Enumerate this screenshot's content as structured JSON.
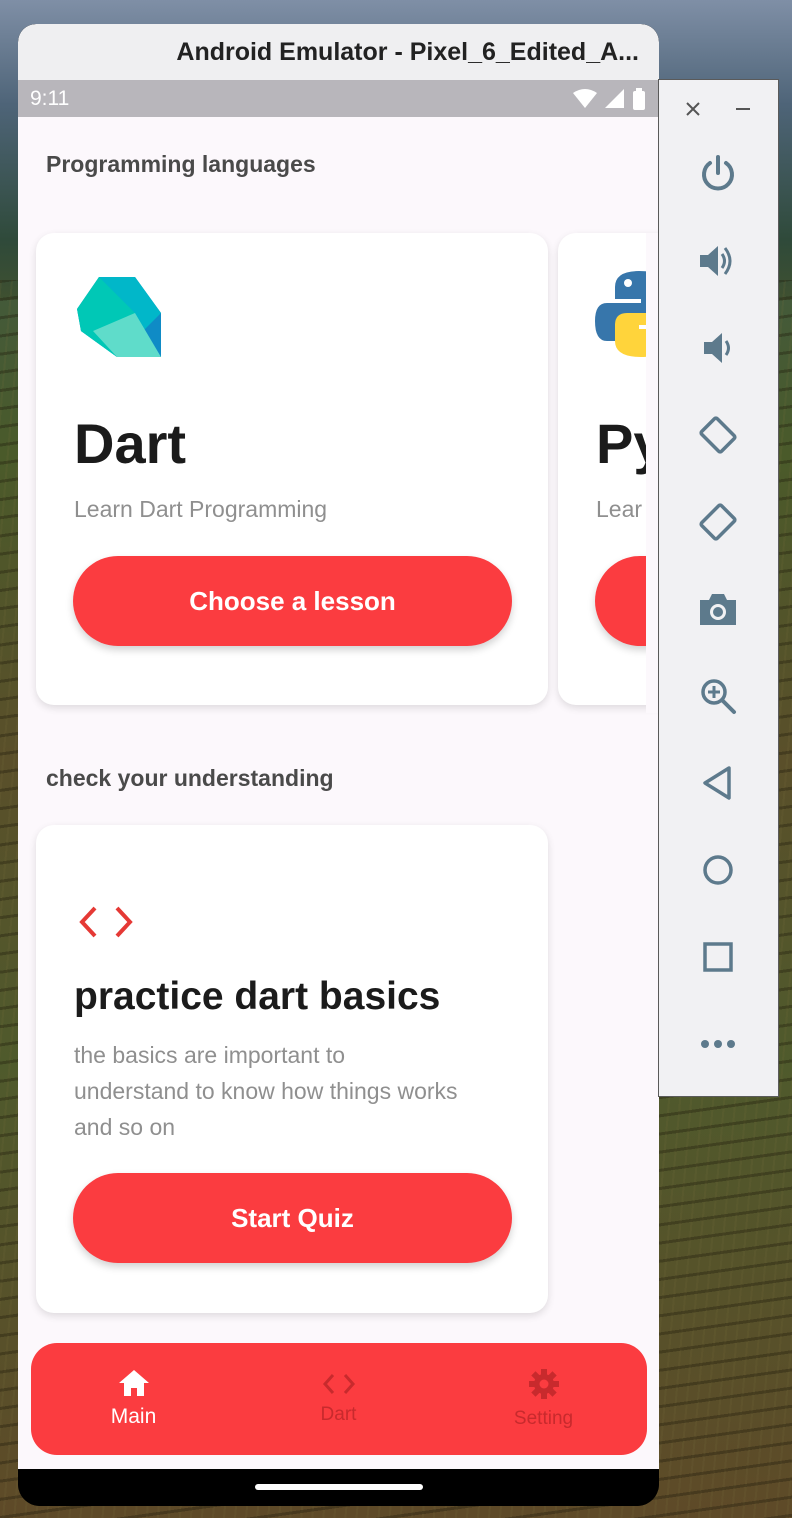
{
  "window": {
    "title": "Android Emulator - Pixel_6_Edited_A..."
  },
  "status_bar": {
    "time": "9:11"
  },
  "sections": {
    "languages_title": "Programming languages",
    "quiz_title": "check your understanding"
  },
  "cards": [
    {
      "title": "Dart",
      "subtitle": "Learn Dart Programming",
      "button": "Choose a lesson",
      "icon": "dart-logo"
    },
    {
      "title": "Py",
      "subtitle": "Lear",
      "icon": "python-logo"
    }
  ],
  "quiz_card": {
    "icon": "code-icon",
    "title": "practice dart basics",
    "description_lines": [
      "the basics are important to",
      "understand to know how things works",
      "and so on"
    ],
    "button": "Start Quiz"
  },
  "bottom_nav": {
    "items": [
      {
        "label": "Main",
        "icon": "home-icon",
        "active": true
      },
      {
        "label": "Dart",
        "icon": "code-icon",
        "active": false
      },
      {
        "label": "Setting",
        "icon": "gear-icon",
        "active": false
      }
    ]
  },
  "toolbar": {
    "items": [
      "power-icon",
      "volume-up-icon",
      "volume-down-icon",
      "rotate-left-icon",
      "rotate-right-icon",
      "camera-icon",
      "zoom-icon",
      "back-icon",
      "home-icon",
      "overview-icon",
      "more-icon"
    ]
  },
  "colors": {
    "accent": "#fb3c40",
    "inactive_nav": "#c82a2d",
    "screen_bg": "#fcf8fc"
  }
}
